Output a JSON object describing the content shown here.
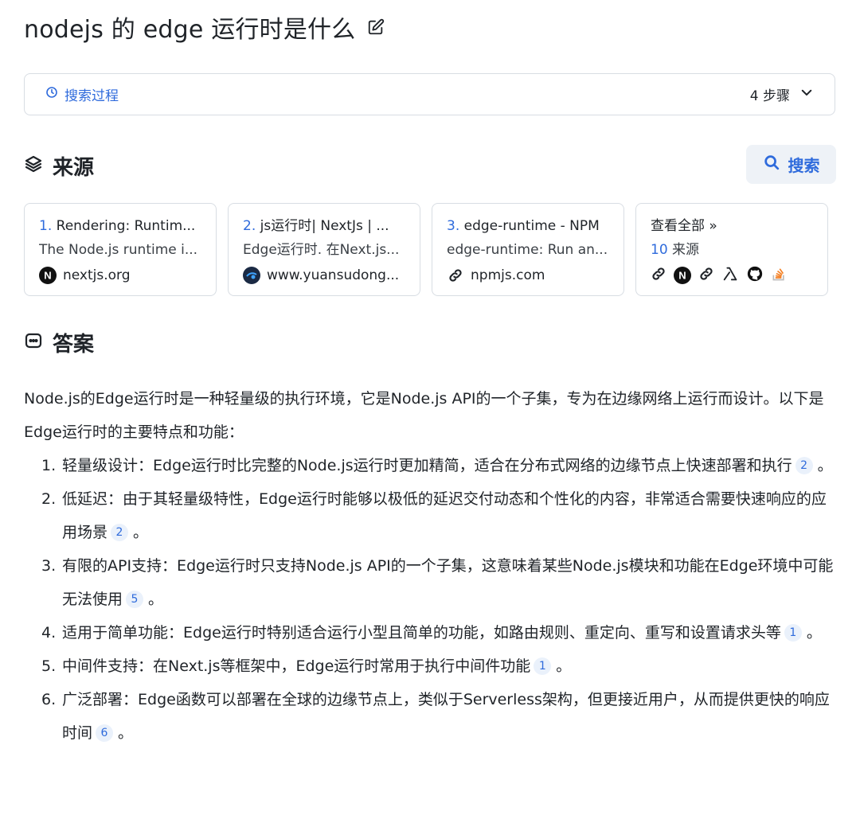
{
  "header": {
    "title": "nodejs 的 edge 运行时是什么"
  },
  "search_process": {
    "label": "搜索过程",
    "steps": "4 步骤"
  },
  "sources": {
    "heading": "来源",
    "search_button": "搜索",
    "cards": [
      {
        "index": "1.",
        "title": "Rendering: Runtim...",
        "snippet": "The Node.js runtime i...",
        "site": "nextjs.org"
      },
      {
        "index": "2.",
        "title": "js运行时| NextJs | ...",
        "snippet": "Edge运行时. 在Next.js...",
        "site": "www.yuansudong..."
      },
      {
        "index": "3.",
        "title": "edge-runtime - NPM",
        "snippet": "edge-runtime: Run an...",
        "site": "npmjs.com"
      }
    ],
    "view_all": {
      "label": "查看全部 »",
      "count": "10",
      "count_label": "来源"
    }
  },
  "answer": {
    "heading": "答案",
    "intro": "Node.js的Edge运行时是一种轻量级的执行环境，它是Node.js API的一个子集，专为在边缘网络上运行而设计。以下是Edge运行时的主要特点和功能：",
    "items": [
      {
        "n": "1.",
        "text": "轻量级设计：Edge运行时比完整的Node.js运行时更加精简，适合在分布式网络的边缘节点上快速部署和执行",
        "cite": "2",
        "end": "。"
      },
      {
        "n": "2.",
        "text": "低延迟：由于其轻量级特性，Edge运行时能够以极低的延迟交付动态和个性化的内容，非常适合需要快速响应的应用场景",
        "cite": "2",
        "end": "。"
      },
      {
        "n": "3.",
        "text": "有限的API支持：Edge运行时只支持Node.js API的一个子集，这意味着某些Node.js模块和功能在Edge环境中可能无法使用",
        "cite": "5",
        "end": "。"
      },
      {
        "n": "4.",
        "text": "适用于简单功能：Edge运行时特别适合运行小型且简单的功能，如路由规则、重定向、重写和设置请求头等",
        "cite": "1",
        "end": "。"
      },
      {
        "n": "5.",
        "text": "中间件支持：在Next.js等框架中，Edge运行时常用于执行中间件功能",
        "cite": "1",
        "end": "。"
      },
      {
        "n": "6.",
        "text": "广泛部署：Edge函数可以部署在全球的边缘节点上，类似于Serverless架构，但更接近用户，从而提供更快的响应时间",
        "cite": "6",
        "end": "。"
      }
    ]
  },
  "colors": {
    "accent": "#2f6bdc",
    "cite_bg": "#eaf1fb",
    "border": "#d8dde3"
  }
}
